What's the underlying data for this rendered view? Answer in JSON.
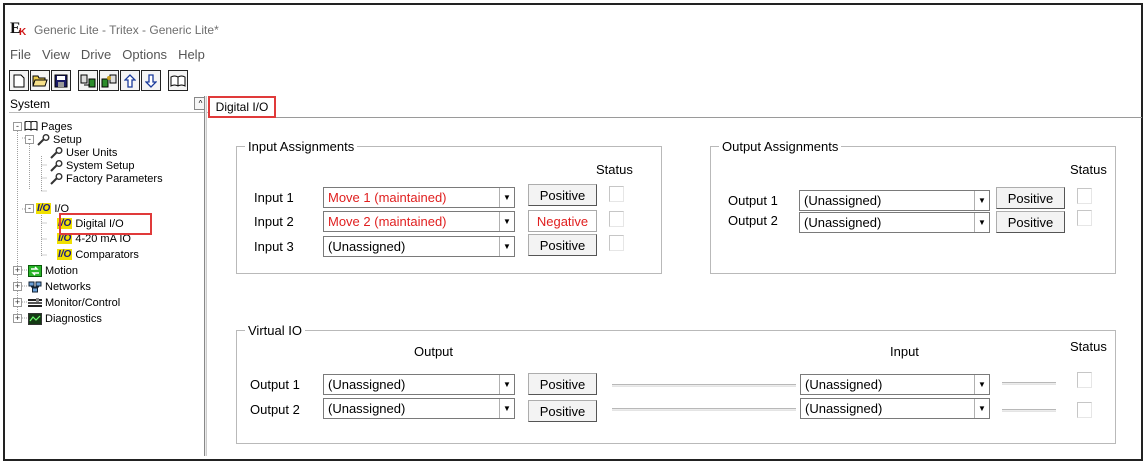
{
  "window": {
    "title": "Generic Lite - Tritex - Generic Lite*"
  },
  "menu": [
    "File",
    "View",
    "Drive",
    "Options",
    "Help"
  ],
  "toolbar": {
    "buttons": [
      "new-icon",
      "open-icon",
      "save-icon",
      "upload-icon",
      "download-icon",
      "arrow-up-icon",
      "arrow-down-icon",
      "book-icon"
    ]
  },
  "tree_pane": {
    "title": "System",
    "collapse_glyph": "^",
    "items": [
      {
        "label": "Pages",
        "expander": "-"
      },
      {
        "label": "Setup",
        "expander": "-"
      },
      {
        "label": "User Units"
      },
      {
        "label": "System Setup"
      },
      {
        "label": "Factory Parameters"
      },
      {
        "label": "I/O",
        "expander": "-"
      },
      {
        "label": "Digital I/O"
      },
      {
        "label": "4-20 mA IO"
      },
      {
        "label": "Comparators"
      },
      {
        "label": "Motion",
        "expander": "+"
      },
      {
        "label": "Networks",
        "expander": "+"
      },
      {
        "label": "Monitor/Control",
        "expander": "+"
      },
      {
        "label": "Diagnostics",
        "expander": "+"
      }
    ],
    "io_icon_text": "I/O"
  },
  "tab": {
    "label": "Digital I/O"
  },
  "input_assignments": {
    "title": "Input Assignments",
    "status_header": "Status",
    "rows": [
      {
        "label": "Input 1",
        "value": "Move 1 (maintained)",
        "polarity": "Positive"
      },
      {
        "label": "Input 2",
        "value": "Move 2 (maintained)",
        "polarity": "Negative"
      },
      {
        "label": "Input 3",
        "value": "(Unassigned)",
        "polarity": "Positive"
      }
    ]
  },
  "output_assignments": {
    "title": "Output Assignments",
    "status_header": "Status",
    "rows": [
      {
        "label": "Output 1",
        "value": "(Unassigned)",
        "polarity": "Positive"
      },
      {
        "label": "Output 2",
        "value": "(Unassigned)",
        "polarity": "Positive"
      }
    ]
  },
  "virtual_io": {
    "title": "Virtual IO",
    "output_header": "Output",
    "input_header": "Input",
    "status_header": "Status",
    "rows": [
      {
        "label": "Output 1",
        "output_value": "(Unassigned)",
        "polarity": "Positive",
        "input_value": "(Unassigned)"
      },
      {
        "label": "Output 2",
        "output_value": "(Unassigned)",
        "polarity": "Positive",
        "input_value": "(Unassigned)"
      }
    ]
  },
  "colors": {
    "highlight": "#e03a3a",
    "negative_text": "#e02020"
  },
  "combo_arrow": "▼"
}
